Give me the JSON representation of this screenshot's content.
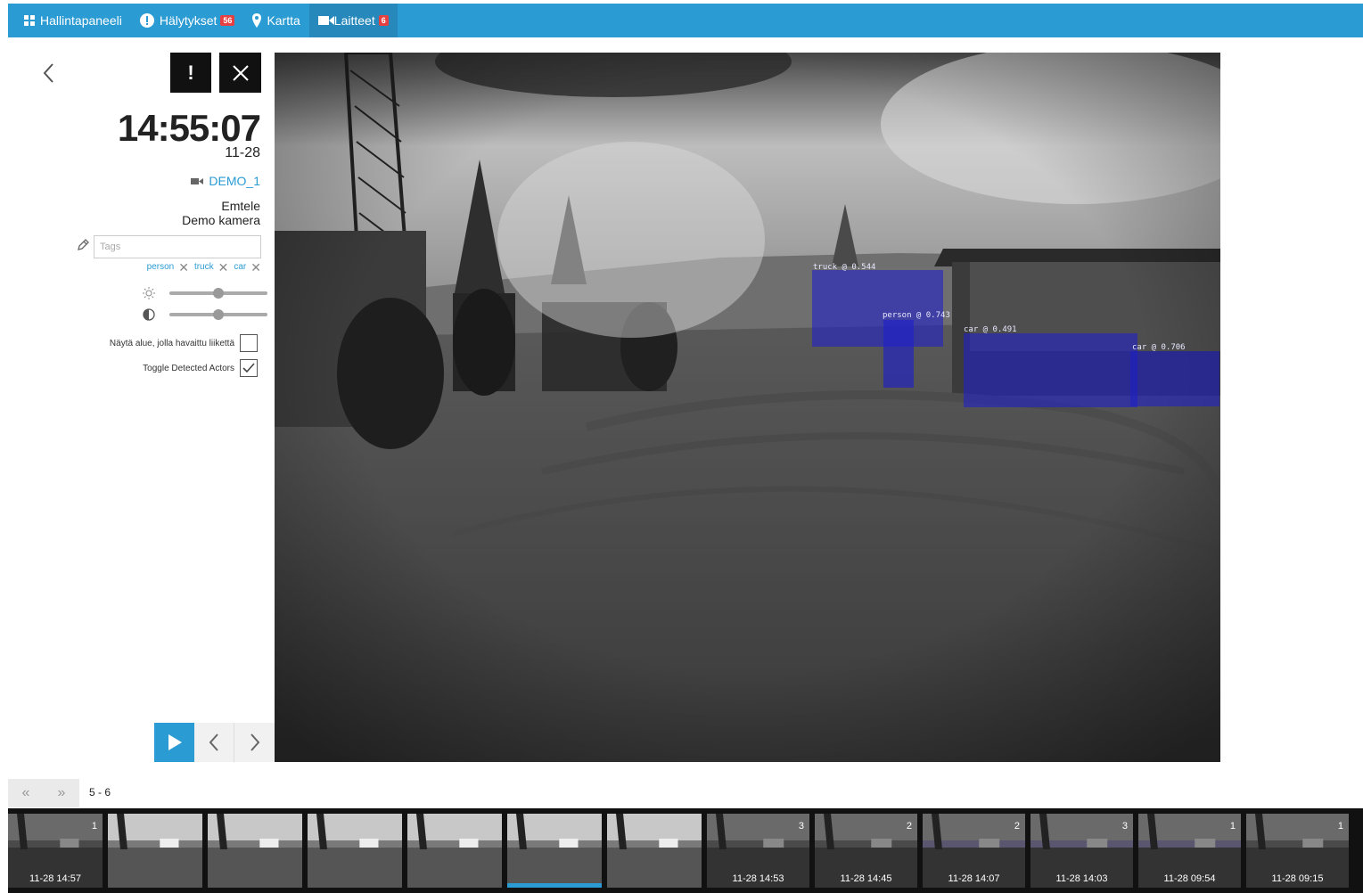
{
  "nav": {
    "dashboard": "Hallintapaneeli",
    "alerts": "Hälytykset",
    "alerts_count": "56",
    "map": "Kartta",
    "devices": "Laitteet",
    "devices_count": "6"
  },
  "event": {
    "time": "14:55:07",
    "date": "11-28",
    "camera_id": "DEMO_1",
    "org": "Emtele",
    "camera_name": "Demo kamera"
  },
  "tags": {
    "placeholder": "Tags",
    "items": [
      "person",
      "truck",
      "car"
    ]
  },
  "adjust": {
    "brightness": 0.5,
    "contrast": 0.5
  },
  "toggles": {
    "motion_label": "Näytä alue, jolla havaittu liikettä",
    "motion_checked": false,
    "actors_label": "Toggle Detected Actors",
    "actors_checked": true
  },
  "detections": [
    {
      "label": "truck @ 0.544"
    },
    {
      "label": "person @ 0.743"
    },
    {
      "label": "car @ 0.491"
    },
    {
      "label": "car @ 0.706"
    }
  ],
  "pagination": {
    "first": "«",
    "prev": "»",
    "range": "5 - 6"
  },
  "thumbnails": [
    {
      "count": "1",
      "time": "11-28 14:57"
    },
    {
      "count": "",
      "time": ""
    },
    {
      "count": "",
      "time": ""
    },
    {
      "count": "",
      "time": ""
    },
    {
      "count": "",
      "time": ""
    },
    {
      "count": "",
      "time": "",
      "active": true
    },
    {
      "count": "",
      "time": ""
    },
    {
      "count": "3",
      "time": "11-28 14:53"
    },
    {
      "count": "2",
      "time": "11-28 14:45"
    },
    {
      "count": "2",
      "time": "11-28 14:07"
    },
    {
      "count": "3",
      "time": "11-28 14:03"
    },
    {
      "count": "1",
      "time": "11-28 09:54"
    },
    {
      "count": "1",
      "time": "11-28 09:15"
    }
  ],
  "colors": {
    "accent": "#2b9bd3",
    "badge": "#e64040",
    "detection": "#2a2ad0"
  }
}
